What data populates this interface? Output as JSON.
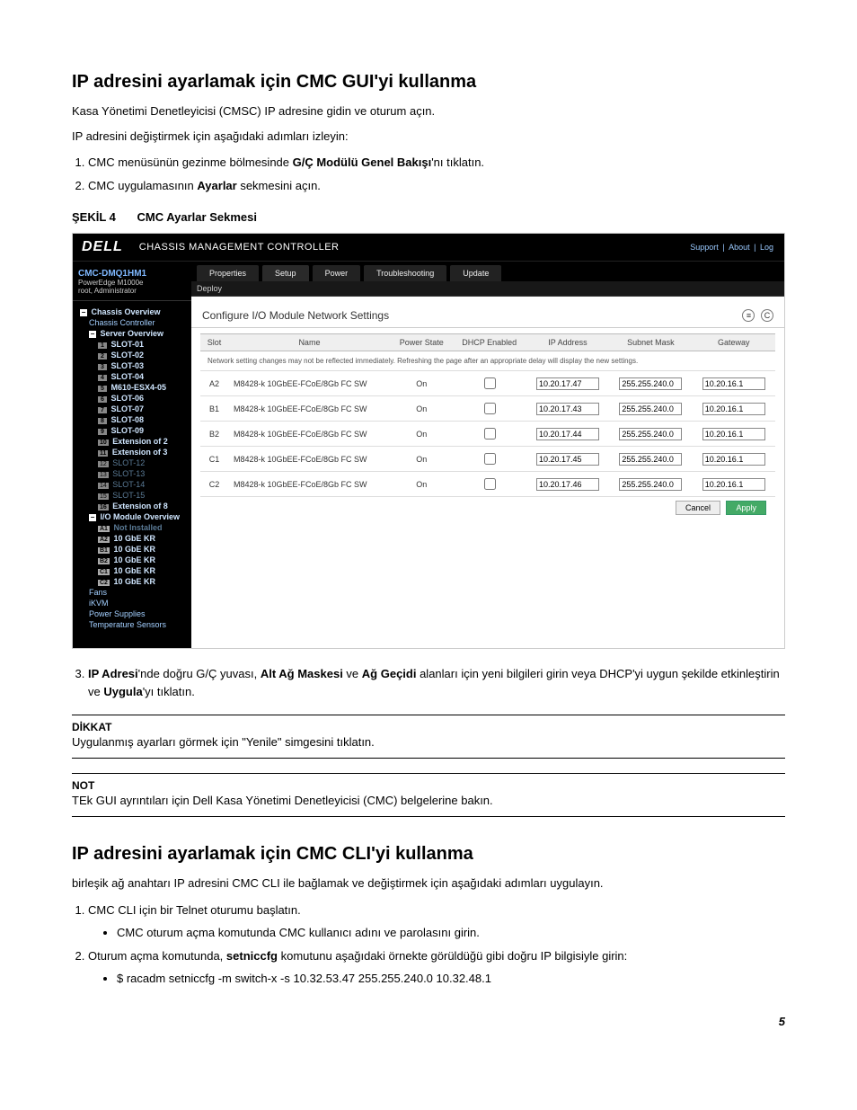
{
  "doc": {
    "h1_gui": "IP adresini ayarlamak için CMC GUI'yi kullanma",
    "p1": "Kasa Yönetimi Denetleyicisi (CMSC) IP adresine gidin ve oturum açın.",
    "p2": "IP adresini değiştirmek için aşağıdaki adımları izleyin:",
    "step1_pre": "CMC menüsünün gezinme bölmesinde ",
    "step1_bold": "G/Ç Modülü Genel Bakışı",
    "step1_post": "'nı tıklatın.",
    "step2_pre": "CMC uygulamasının ",
    "step2_bold": "Ayarlar",
    "step2_post": " sekmesini açın.",
    "fig_num": "ŞEKİL 4",
    "fig_title": "CMC Ayarlar Sekmesi",
    "step3a_bold": "IP Adresi",
    "step3a_mid": "'nde doğru G/Ç yuvası, ",
    "step3b_bold": "Alt Ağ Maskesi",
    "step3b_mid": " ve ",
    "step3c_bold": "Ağ Geçidi",
    "step3c_mid": " alanları için yeni bilgileri girin veya DHCP'yi uygun şekilde etkinleştirin ve ",
    "step3d_bold": "Uygula",
    "step3d_post": "'yı tıklatın.",
    "dikkat_label": "DİKKAT",
    "dikkat_text": "Uygulanmış ayarları görmek için \"Yenile\" simgesini tıklatın.",
    "not_label": "NOT",
    "not_text": "TEk GUI ayrıntıları için Dell Kasa Yönetimi Denetleyicisi (CMC) belgelerine bakın.",
    "h1_cli": "IP adresini ayarlamak için CMC CLI'yi kullanma",
    "cli_intro": "birleşik ağ anahtarı IP adresini CMC CLI ile bağlamak ve değiştirmek için aşağıdaki adımları uygulayın.",
    "cli1": "CMC CLI için bir Telnet oturumu başlatın.",
    "cli1_b": "CMC oturum açma komutunda CMC kullanıcı adını ve parolasını girin.",
    "cli2_pre": "Oturum açma komutunda, ",
    "cli2_bold": "setniccfg",
    "cli2_post": " komutunu aşağıdaki örnekte görüldüğü gibi doğru IP bilgisiyle girin:",
    "cli2_cmd": "$ racadm setniccfg -m switch-x -s 10.32.53.47 255.255.240.0 10.32.48.1",
    "page_footer": "5"
  },
  "scr": {
    "logo": "DELL",
    "header_title": "CHASSIS MANAGEMENT CONTROLLER",
    "links": [
      "Support",
      "About",
      "Log"
    ],
    "user": {
      "name": "CMC-DMQ1HM1",
      "model": "PowerEdge M1000e",
      "role": "root, Administrator"
    },
    "tree_root": "Chassis Overview",
    "tree_cc": "Chassis Controller",
    "tree_so": "Server Overview",
    "slots": [
      {
        "n": "1",
        "t": "SLOT-01"
      },
      {
        "n": "2",
        "t": "SLOT-02"
      },
      {
        "n": "3",
        "t": "SLOT-03"
      },
      {
        "n": "4",
        "t": "SLOT-04"
      },
      {
        "n": "5",
        "t": "M610-ESX4-05"
      },
      {
        "n": "6",
        "t": "SLOT-06"
      },
      {
        "n": "7",
        "t": "SLOT-07"
      },
      {
        "n": "8",
        "t": "SLOT-08"
      },
      {
        "n": "9",
        "t": "SLOT-09"
      },
      {
        "n": "10",
        "t": "Extension of 2"
      },
      {
        "n": "11",
        "t": "Extension of 3"
      },
      {
        "n": "12",
        "t": "SLOT-12",
        "dim": true
      },
      {
        "n": "13",
        "t": "SLOT-13",
        "dim": true
      },
      {
        "n": "14",
        "t": "SLOT-14",
        "dim": true
      },
      {
        "n": "15",
        "t": "SLOT-15",
        "dim": true
      },
      {
        "n": "16",
        "t": "Extension of 8"
      }
    ],
    "tree_io": "I/O Module Overview",
    "io_items": [
      {
        "n": "A1",
        "t": "Not Installed",
        "dim": true
      },
      {
        "n": "A2",
        "t": "10 GbE KR"
      },
      {
        "n": "B1",
        "t": "10 GbE KR"
      },
      {
        "n": "B2",
        "t": "10 GbE KR"
      },
      {
        "n": "C1",
        "t": "10 GbE KR"
      },
      {
        "n": "C2",
        "t": "10 GbE KR"
      }
    ],
    "tree_other": [
      "Fans",
      "iKVM",
      "Power Supplies",
      "Temperature Sensors"
    ],
    "tabs": [
      "Properties",
      "Setup",
      "Power",
      "Troubleshooting",
      "Update"
    ],
    "subtab": "Deploy",
    "panel_title": "Configure I/O Module Network Settings",
    "th": [
      "Slot",
      "Name",
      "Power State",
      "DHCP Enabled",
      "IP Address",
      "Subnet Mask",
      "Gateway"
    ],
    "note": "Network setting changes may not be reflected immediately. Refreshing the page after an appropriate delay will display the new settings.",
    "rows": [
      {
        "slot": "A2",
        "name": "M8428-k 10GbEE-FCoE/8Gb FC SW",
        "ps": "On",
        "dhcp": false,
        "ip": "10.20.17.47",
        "mask": "255.255.240.0",
        "gw": "10.20.16.1"
      },
      {
        "slot": "B1",
        "name": "M8428-k 10GbEE-FCoE/8Gb FC SW",
        "ps": "On",
        "dhcp": false,
        "ip": "10.20.17.43",
        "mask": "255.255.240.0",
        "gw": "10.20.16.1"
      },
      {
        "slot": "B2",
        "name": "M8428-k 10GbEE-FCoE/8Gb FC SW",
        "ps": "On",
        "dhcp": false,
        "ip": "10.20.17.44",
        "mask": "255.255.240.0",
        "gw": "10.20.16.1"
      },
      {
        "slot": "C1",
        "name": "M8428-k 10GbEE-FCoE/8Gb FC SW",
        "ps": "On",
        "dhcp": false,
        "ip": "10.20.17.45",
        "mask": "255.255.240.0",
        "gw": "10.20.16.1"
      },
      {
        "slot": "C2",
        "name": "M8428-k 10GbEE-FCoE/8Gb FC SW",
        "ps": "On",
        "dhcp": false,
        "ip": "10.20.17.46",
        "mask": "255.255.240.0",
        "gw": "10.20.16.1"
      }
    ],
    "cancel_btn": "Cancel",
    "apply_btn": "Apply"
  }
}
